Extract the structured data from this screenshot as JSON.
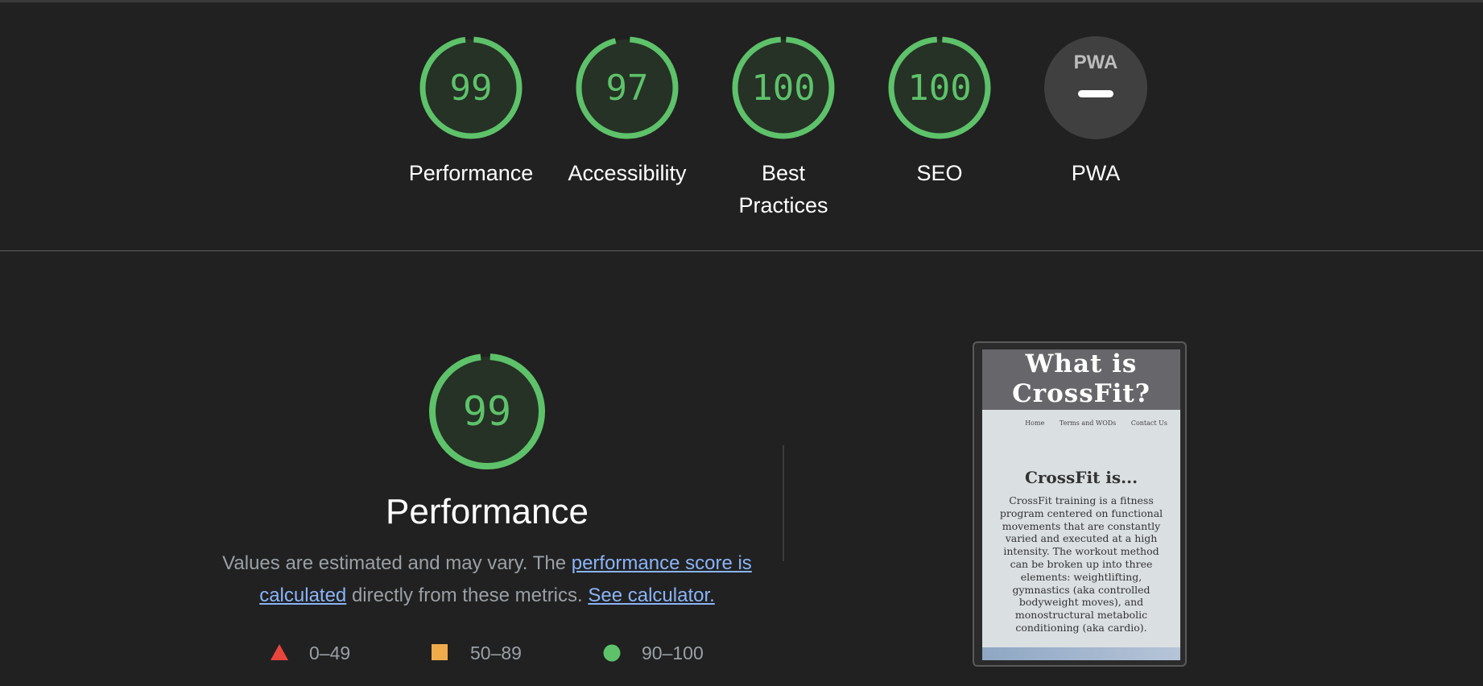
{
  "summary": {
    "gauges": [
      {
        "score": "99",
        "label": "Performance",
        "value": 99
      },
      {
        "score": "97",
        "label": "Accessibility",
        "value": 97
      },
      {
        "score": "100",
        "label": "Best Practices",
        "value": 100
      },
      {
        "score": "100",
        "label": "SEO",
        "value": 100
      },
      {
        "score": "",
        "label": "PWA",
        "badge": "PWA"
      }
    ]
  },
  "performance": {
    "score": "99",
    "value": 99,
    "title": "Performance",
    "desc_prefix": "Values are estimated and may vary. The ",
    "link1": "performance score is calculated",
    "desc_middle": " directly from these metrics. ",
    "link2": "See calculator."
  },
  "legend": {
    "fail": "0–49",
    "average": "50–89",
    "pass": "90–100"
  },
  "screenshot": {
    "hero_line1": "What is",
    "hero_line2": "CrossFit?",
    "nav": [
      "Home",
      "Terms and WODs",
      "Contact Us"
    ],
    "heading": "CrossFit is...",
    "body": "CrossFit training is a fitness program centered on functional movements that are constantly varied and executed at a high intensity. The workout method can be broken up into three elements: weightlifting, gymnastics (aka controlled bodyweight moves), and monostructural metabolic conditioning (aka cardio)."
  },
  "colors": {
    "pass": "#5ec26a",
    "pass_fill": "#263226",
    "average": "#f0ac4a",
    "fail": "#e8453c",
    "pwa_gray": "#404040",
    "link": "#8ab4f8"
  },
  "icons": {
    "gauge": "circular-score-gauge",
    "pwa": "pwa-badge-icon",
    "fail": "red-triangle-icon",
    "average": "orange-square-icon",
    "pass": "green-circle-icon"
  }
}
